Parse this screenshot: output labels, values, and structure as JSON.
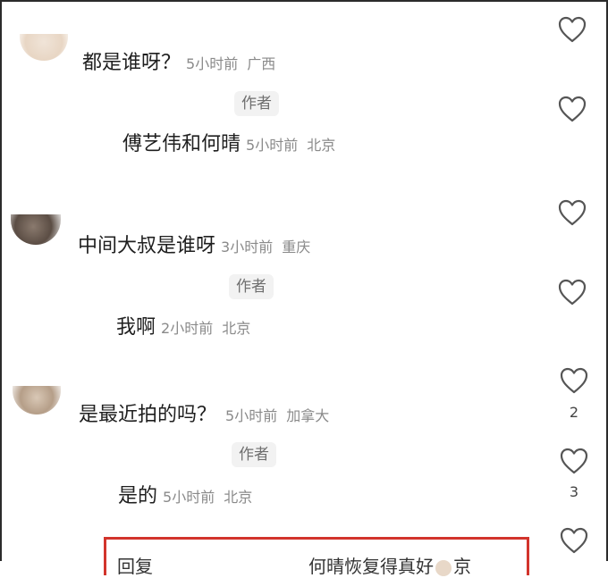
{
  "comments": [
    {
      "text": "都是谁呀？",
      "time": "5小时前",
      "location": "广西",
      "likes": ""
    },
    {
      "author_badge": "作者",
      "text": "傅艺伟和何晴",
      "time": "5小时前",
      "location": "北京",
      "likes": ""
    },
    {
      "text": "中间大叔是谁呀",
      "time": "3小时前",
      "location": "重庆",
      "likes": ""
    },
    {
      "author_badge": "作者",
      "text": "我啊",
      "time": "2小时前",
      "location": "北京",
      "likes": ""
    },
    {
      "text": "是最近拍的吗？",
      "time": "5小时前",
      "location": "加拿大",
      "likes": "2"
    },
    {
      "author_badge": "作者",
      "text": "是的",
      "time": "5小时前",
      "location": "北京",
      "likes": "3"
    }
  ],
  "reply_box": {
    "label": "回复",
    "text": "何晴恢复得真好",
    "suffix": "京"
  },
  "colors": {
    "highlight_border": "#d2342c",
    "meta_text": "#8a8a8a"
  },
  "icons": {
    "like": "heart-outline-icon"
  }
}
